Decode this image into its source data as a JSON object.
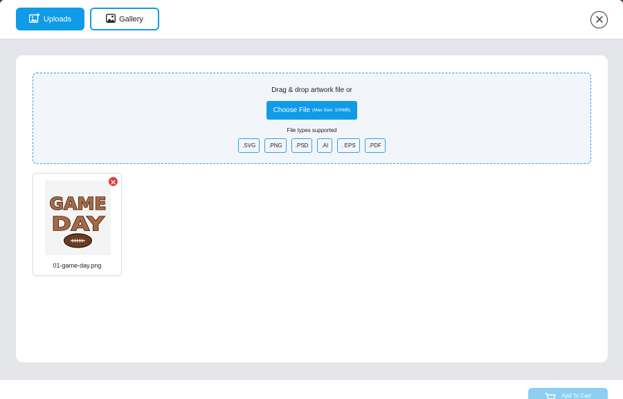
{
  "header": {
    "tabs": [
      {
        "label": "Uploads",
        "active": true,
        "icon": "add-image-icon"
      },
      {
        "label": "Gallery",
        "active": false,
        "icon": "image-icon"
      }
    ],
    "close_icon": "close-icon"
  },
  "dropzone": {
    "title": "Drag & drop artwork file or",
    "choose_label": "Choose File",
    "max_size": "(Max Size: 100MB)",
    "file_types_label": "File types supported",
    "file_types": [
      ".SVG",
      ".PNG",
      ".PSD",
      ".AI",
      ". EPS",
      ".PDF"
    ]
  },
  "uploads": [
    {
      "filename": "01-game-day.png",
      "image_text_line1": "GAME",
      "image_text_line2": "DAY"
    }
  ],
  "footer": {
    "add_to_cart_label": "Add To Cart",
    "cart_icon": "cart-icon"
  },
  "colors": {
    "primary": "#109be8",
    "remove": "#e23c3c",
    "cart_disabled": "#8ccff2"
  }
}
